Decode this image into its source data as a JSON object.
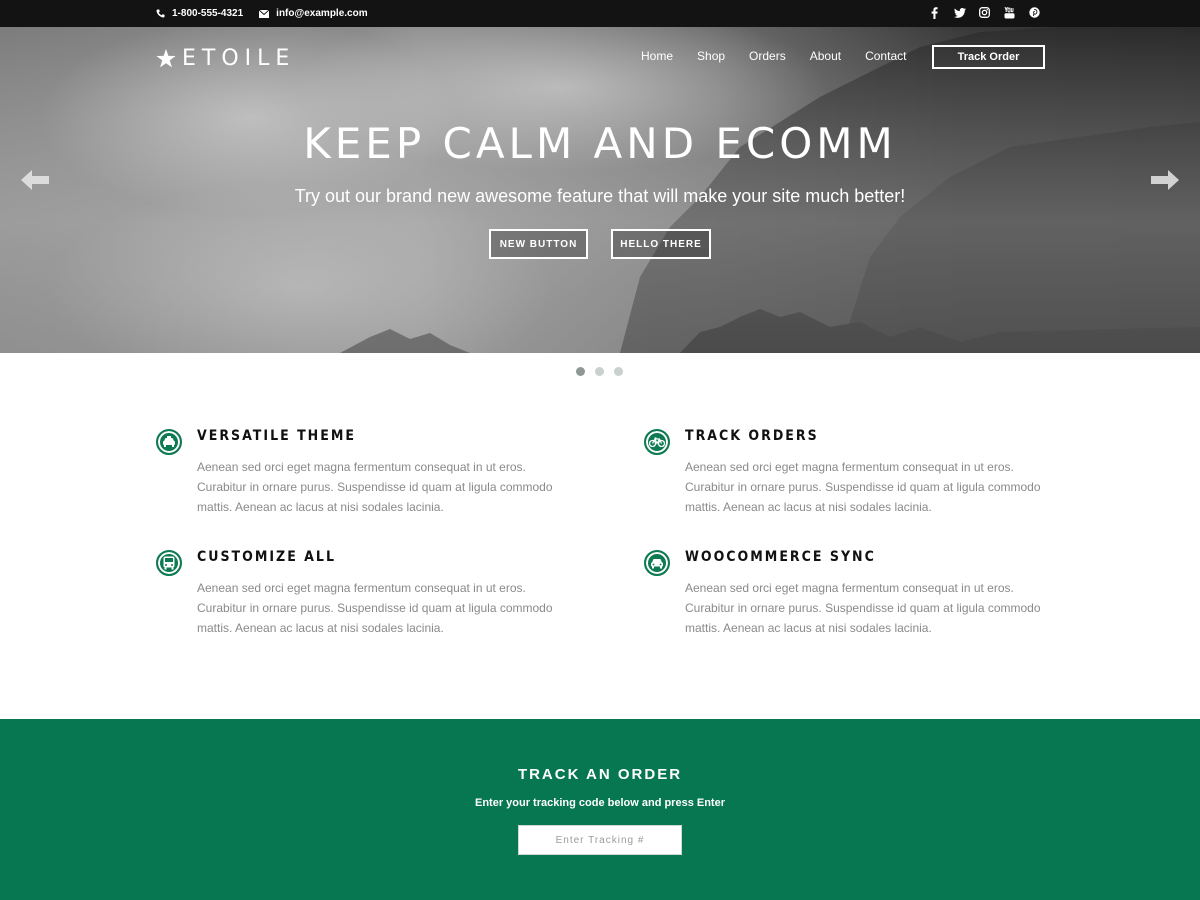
{
  "topbar": {
    "phone": "1-800-555-4321",
    "email": "info@example.com",
    "social_icons": [
      "facebook-icon",
      "twitter-icon",
      "instagram-icon",
      "youtube-icon",
      "pinterest-icon"
    ]
  },
  "header": {
    "logo_text": "ETOILE",
    "nav": [
      "Home",
      "Shop",
      "Orders",
      "About",
      "Contact"
    ],
    "track_order_label": "Track Order"
  },
  "hero": {
    "title": "KEEP CALM AND ECOMM",
    "subtitle": "Try out our brand new awesome feature that will make your site much better!",
    "button_1": "NEW BUTTON",
    "button_2": "HELLO THERE",
    "slide_count": 3,
    "active_slide": 1
  },
  "features": [
    {
      "icon": "taxi-icon",
      "title": "VERSATILE THEME",
      "text": "Aenean sed orci eget magna fermentum consequat in ut eros. Curabitur in ornare purus. Suspendisse id quam at ligula commodo mattis. Aenean ac lacus at nisi sodales lacinia."
    },
    {
      "icon": "bicycle-icon",
      "title": "TRACK ORDERS",
      "text": "Aenean sed orci eget magna fermentum consequat in ut eros. Curabitur in ornare purus. Suspendisse id quam at ligula commodo mattis. Aenean ac lacus at nisi sodales lacinia."
    },
    {
      "icon": "bus-icon",
      "title": "CUSTOMIZE ALL",
      "text": "Aenean sed orci eget magna fermentum consequat in ut eros. Curabitur in ornare purus. Suspendisse id quam at ligula commodo mattis. Aenean ac lacus at nisi sodales lacinia."
    },
    {
      "icon": "car-icon",
      "title": "WOOCOMMERCE SYNC",
      "text": "Aenean sed orci eget magna fermentum consequat in ut eros. Curabitur in ornare purus. Suspendisse id quam at ligula commodo mattis. Aenean ac lacus at nisi sodales lacinia."
    }
  ],
  "track_section": {
    "title": "TRACK AN ORDER",
    "subtitle": "Enter your tracking code below and press Enter",
    "input_placeholder": "Enter Tracking #",
    "input_value": ""
  },
  "colors": {
    "brand_green": "#077752",
    "topbar_bg": "#131313"
  }
}
